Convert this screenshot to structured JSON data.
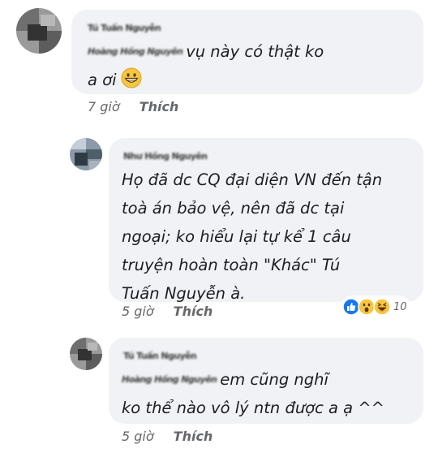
{
  "comments": [
    {
      "author": "Tú Tuấn Nguyễn",
      "mention": "Hoàng Hồng Nguyên",
      "text_lines": [
        "vụ này có thật ko",
        "a ơi"
      ],
      "emoji": "grinning-face-icon",
      "time": "7 giờ",
      "like_label": "Thích"
    },
    {
      "author": "Như Hồng Nguyên",
      "text_lines": [
        "Họ đã dc CQ đại diện VN đến tận",
        "toà án bảo vệ, nên đã dc tại",
        "ngoại; ko hiểu lại tự kể 1 câu",
        "truyện hoàn toàn \"Khác\"  Tú",
        "Tuấn Nguyễn à."
      ],
      "time": "5 giờ",
      "like_label": "Thích",
      "reactions": {
        "icons": [
          "like-icon",
          "wow-icon",
          "haha-icon"
        ],
        "count": "10"
      }
    },
    {
      "author": "Tú Tuấn Nguyễn",
      "mention": "Hoàng Hồng Nguyên",
      "text_lines": [
        "em cũng nghĩ",
        "ko thể nào vô lý ntn được a ạ ^^"
      ],
      "time": "5 giờ",
      "like_label": "Thích"
    }
  ],
  "colors": {
    "bubble": "#f0f2f5",
    "text": "#1c1e21",
    "meta": "#65676b",
    "like_blue": "#1877f2",
    "emoji_yellow": "#f7c63f"
  }
}
